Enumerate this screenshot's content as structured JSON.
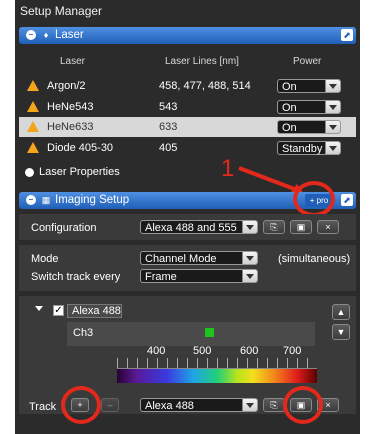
{
  "app": {
    "title": "Setup Manager"
  },
  "laser_panel": {
    "title": "Laser",
    "columns": [
      "Laser",
      "Laser Lines [nm]",
      "Power"
    ],
    "rows": [
      {
        "name": "Argon/2",
        "lines": "458, 477, 488, 514",
        "power": "On"
      },
      {
        "name": "HeNe543",
        "lines": "543",
        "power": "On"
      },
      {
        "name": "HeNe633",
        "lines": "633",
        "power": "On"
      },
      {
        "name": "Diode 405-30",
        "lines": "405",
        "power": "Standby"
      }
    ],
    "properties_label": "Laser Properties"
  },
  "annotation": {
    "step_number": "1"
  },
  "imaging_panel": {
    "title": "Imaging Setup",
    "pro_label": "+ pro",
    "configuration_label": "Configuration",
    "configuration_value": "Alexa 488 and 555",
    "mode_label": "Mode",
    "mode_value": "Channel Mode",
    "mode_note": "(simultaneous)",
    "switch_label": "Switch track every",
    "switch_value": "Frame",
    "track_name": "Alexa 488",
    "channel_name": "Ch3",
    "wavelength_ticks": [
      "400",
      "500",
      "600",
      "700"
    ],
    "track_label": "Track",
    "add_label": "+",
    "track_select_value": "Alexa 488"
  },
  "colors": {
    "panel_header_top": "#4f90e2",
    "panel_header_bottom": "#1f5fb7",
    "warning": "#f3a51c",
    "annotation_red": "#e3281c",
    "background": "#2b2b2b"
  }
}
